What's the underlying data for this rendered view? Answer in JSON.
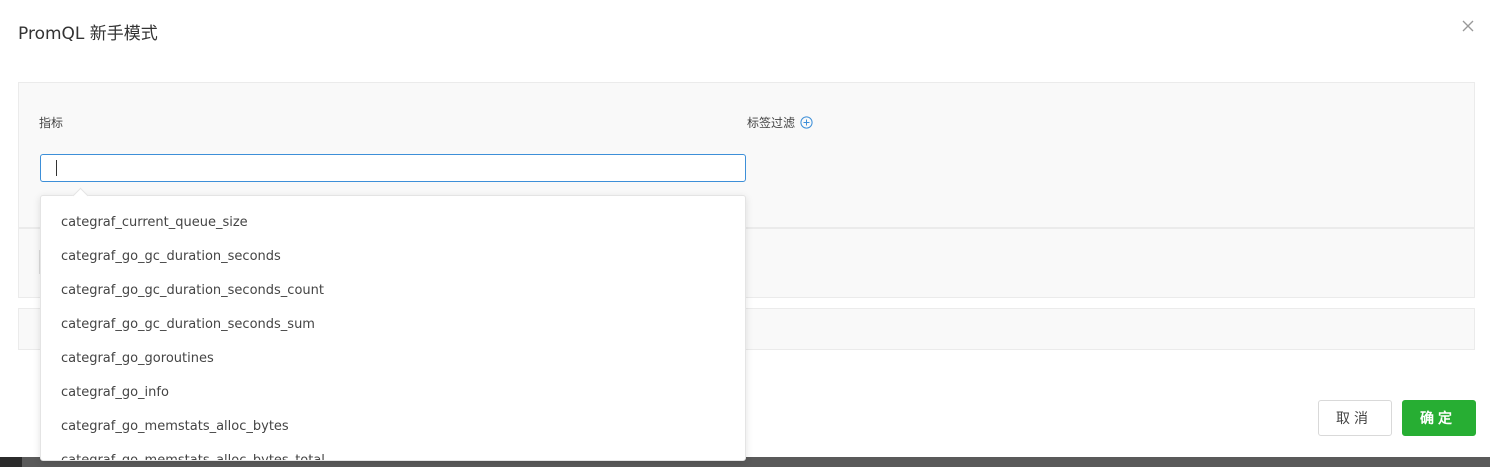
{
  "dialog": {
    "title": "PromQL 新手模式",
    "close_icon": "close-icon"
  },
  "builder": {
    "metric_label": "指标",
    "metric_input_value": "",
    "label_filter_label": "标签过滤",
    "add_filter_icon": "plus-circle-icon"
  },
  "dropdown": {
    "items": [
      "categraf_current_queue_size",
      "categraf_go_gc_duration_seconds",
      "categraf_go_gc_duration_seconds_count",
      "categraf_go_gc_duration_seconds_sum",
      "categraf_go_goroutines",
      "categraf_go_info",
      "categraf_go_memstats_alloc_bytes",
      "categraf_go_memstats_alloc_bytes_total"
    ]
  },
  "footer": {
    "cancel_label": "取消",
    "ok_label": "确定"
  },
  "colors": {
    "accent_blue": "#3d8fd8",
    "ok_green": "#27ae33"
  }
}
